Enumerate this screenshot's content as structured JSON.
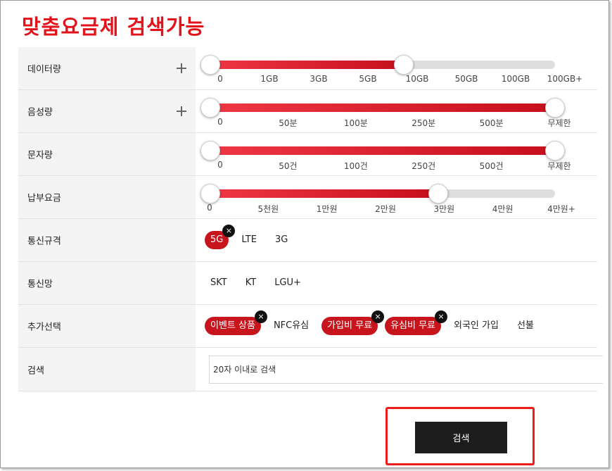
{
  "title": "맞춤요금제 검색가능",
  "filters": {
    "data": {
      "label": "데이터량",
      "ticks": [
        "0",
        "1GB",
        "3GB",
        "5GB",
        "10GB",
        "50GB",
        "100GB",
        "100GB+"
      ],
      "selected_range": [
        "0",
        "10GB"
      ],
      "fill_fraction": 0.57
    },
    "voice": {
      "label": "음성량",
      "ticks": [
        "0",
        "50분",
        "100분",
        "250분",
        "500분",
        "무제한"
      ],
      "selected_range": [
        "0",
        "무제한"
      ],
      "fill_fraction": 1.0
    },
    "sms": {
      "label": "문자량",
      "ticks": [
        "0",
        "50건",
        "100건",
        "250건",
        "500건",
        "무제한"
      ],
      "selected_range": [
        "0",
        "무제한"
      ],
      "fill_fraction": 1.0
    },
    "fee": {
      "label": "납부요금",
      "ticks": [
        "0",
        "5천원",
        "1만원",
        "2만원",
        "3만원",
        "4만원",
        "4만원+"
      ],
      "selected_range": [
        "0",
        "3만원"
      ],
      "fill_fraction": 0.67
    },
    "network_type": {
      "label": "통신규격",
      "options": [
        {
          "label": "5G",
          "selected": true
        },
        {
          "label": "LTE",
          "selected": false
        },
        {
          "label": "3G",
          "selected": false
        }
      ]
    },
    "carrier": {
      "label": "통신망",
      "options": [
        {
          "label": "SKT",
          "selected": false
        },
        {
          "label": "KT",
          "selected": false
        },
        {
          "label": "LGU+",
          "selected": false
        }
      ]
    },
    "extras": {
      "label": "추가선택",
      "options": [
        {
          "label": "이벤트 상품",
          "selected": true
        },
        {
          "label": "NFC유심",
          "selected": false
        },
        {
          "label": "가입비 무료",
          "selected": true
        },
        {
          "label": "유심비 무료",
          "selected": true
        },
        {
          "label": "외국인 가입",
          "selected": false
        },
        {
          "label": "선불",
          "selected": false
        }
      ]
    },
    "search": {
      "label": "검색",
      "placeholder": "20자 이내로 검색",
      "value": ""
    }
  },
  "close_glyph": "×",
  "search_button_label": "검색",
  "colors": {
    "accent": "#e3121a",
    "chip_selected": "#c8151d",
    "button": "#1d1d1d",
    "highlight_box": "#ee1c1c"
  }
}
